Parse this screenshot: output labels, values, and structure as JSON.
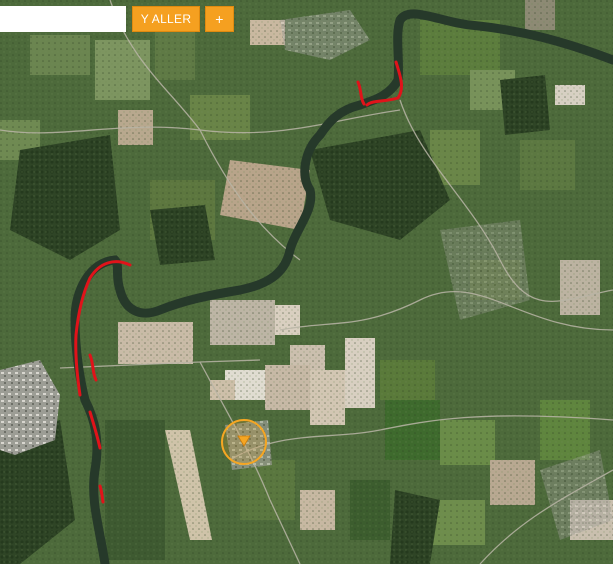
{
  "search": {
    "placeholder": "",
    "value": ""
  },
  "toolbar": {
    "go_label": "Y ALLER",
    "add_label": "+"
  },
  "map": {
    "type": "satellite",
    "colors": {
      "highlight": "#e0131a",
      "marker": "#f5a623",
      "river": "#26392a",
      "town": "#a9aaa3",
      "button": "#f5a020"
    },
    "marker": {
      "icon": "location-target-icon"
    }
  }
}
